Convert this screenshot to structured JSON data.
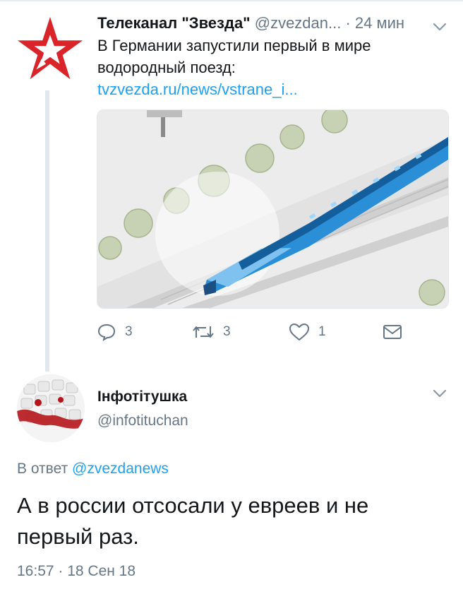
{
  "tweet1": {
    "name": "Телеканал \"Звезда\"",
    "handle": "@zvezdan...",
    "time": "· 24 мин",
    "text_plain": "В Германии запустили первый в мире водородный поезд: ",
    "text_link": "tvzvezda.ru/news/vstrane_i...",
    "actions": {
      "replies": "3",
      "retweets": "3",
      "likes": "1"
    }
  },
  "tweet2": {
    "name": "Інфотітушка",
    "handle": "@infotituchan",
    "reply_prefix": "В ответ ",
    "reply_to": "@zvezdanews",
    "text": "А в россии отсосали у евреев и не первый раз.",
    "timestamp": "16:57 · 18 Сен 18"
  },
  "colors": {
    "link": "#1da1f2",
    "secondary": "#657786",
    "primary": "#14171a",
    "logo_red": "#d9252a",
    "train_blue": "#2a8fd6"
  },
  "icons": [
    "zvezda-logo",
    "chevron-down-icon",
    "reply-icon",
    "retweet-icon",
    "like-icon",
    "dm-icon"
  ]
}
